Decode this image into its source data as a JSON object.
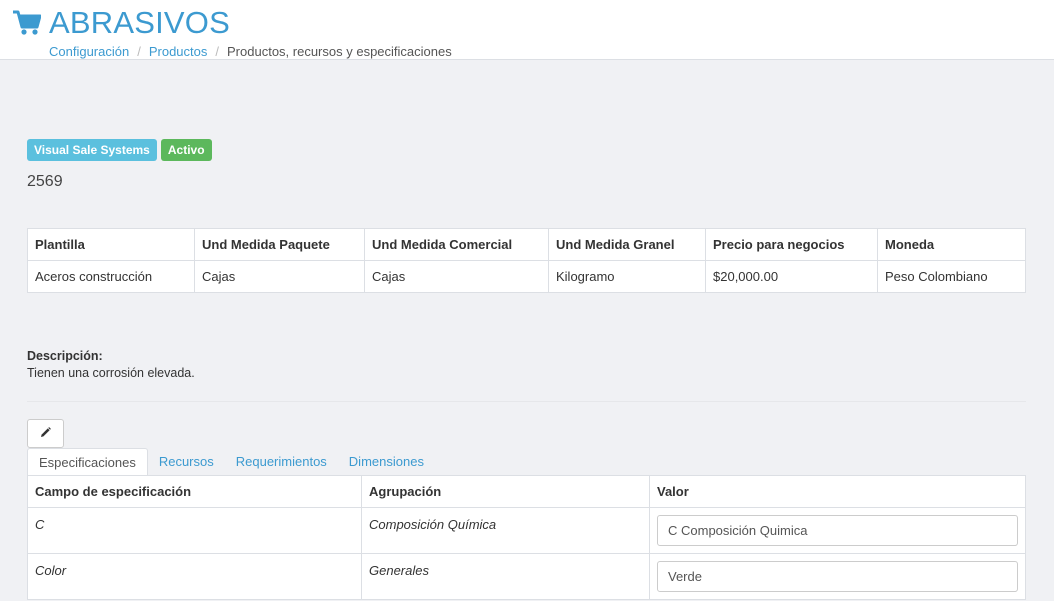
{
  "header": {
    "title": "ABRASIVOS",
    "icon": "shopping-cart-icon",
    "breadcrumb": [
      {
        "label": "Configuración"
      },
      {
        "label": "Productos"
      },
      {
        "label": "Productos, recursos y especificaciones"
      }
    ]
  },
  "product": {
    "badges": [
      {
        "label": "Visual Sale Systems",
        "color": "#5bc0de"
      },
      {
        "label": "Activo",
        "color": "#5cb85c"
      }
    ],
    "code": "2569"
  },
  "info_table": {
    "headers": [
      "Plantilla",
      "Und Medida Paquete",
      "Und Medida Comercial",
      "Und Medida Granel",
      "Precio para negocios",
      "Moneda"
    ],
    "row": [
      "Aceros construcción",
      "Cajas",
      "Cajas",
      "Kilogramo",
      "$20,000.00",
      "Peso Colombiano"
    ]
  },
  "description": {
    "label": "Descripción:",
    "text": "Tienen una corrosión elevada."
  },
  "edit_icon": "pencil-icon",
  "tabs": [
    {
      "label": "Especificaciones",
      "active": true
    },
    {
      "label": "Recursos",
      "active": false
    },
    {
      "label": "Requerimientos",
      "active": false
    },
    {
      "label": "Dimensiones",
      "active": false
    }
  ],
  "spec_table": {
    "headers": [
      "Campo de especificación",
      "Agrupación",
      "Valor"
    ],
    "rows": [
      {
        "campo": "C",
        "agrupacion": "Composición Química",
        "valor": "C Composición Quimica"
      },
      {
        "campo": "Color",
        "agrupacion": "Generales",
        "valor": "Verde"
      }
    ]
  },
  "colors": {
    "accent": "#3c9ad0",
    "background": "#f0f1f4"
  }
}
